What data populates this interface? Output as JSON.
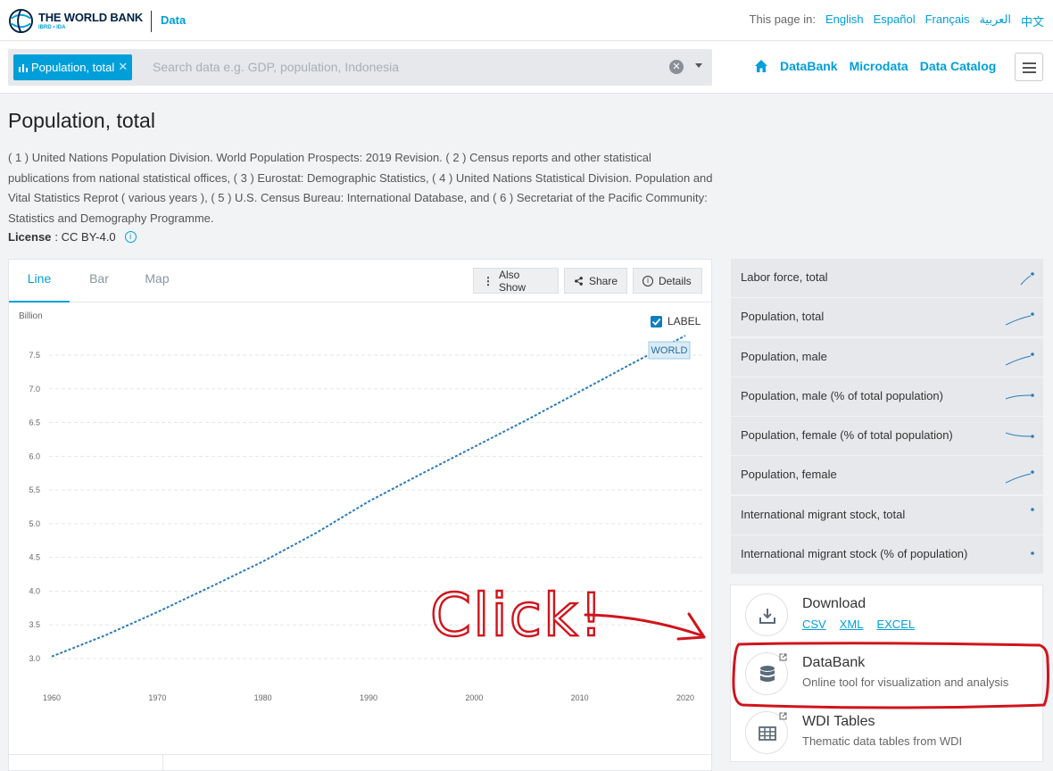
{
  "header": {
    "logo_main": "THE WORLD BANK",
    "logo_sub": "IBRD • IDA",
    "section": "Data",
    "lang_label": "This page in:",
    "languages": [
      "English",
      "Español",
      "Français",
      "العربية",
      "中文"
    ]
  },
  "search": {
    "chip_label": "Population, total",
    "placeholder": "Search data e.g. GDP, population, Indonesia"
  },
  "nav": {
    "links": [
      "DataBank",
      "Microdata",
      "Data Catalog"
    ]
  },
  "page": {
    "title": "Population, total",
    "source": "( 1 ) United Nations Population Division. World Population Prospects: 2019 Revision. ( 2 ) Census reports and other statistical publications from national statistical offices, ( 3 ) Eurostat: Demographic Statistics, ( 4 ) United Nations Statistical Division. Population and Vital Statistics Reprot ( various years ), ( 5 ) U.S. Census Bureau: International Database, and ( 6 ) Secretariat of the Pacific Community: Statistics and Demography Programme.",
    "license_label": "License",
    "license_value": ": CC BY-4.0"
  },
  "chart_tabs": [
    "Line",
    "Bar",
    "Map"
  ],
  "chart_buttons": [
    "Also Show",
    "Share",
    "Details"
  ],
  "chart_data": {
    "type": "line",
    "unit_label": "Billion",
    "label_checkbox": "LABEL",
    "series": [
      {
        "name": "WORLD",
        "x": [
          1960,
          1965,
          1970,
          1975,
          1980,
          1985,
          1990,
          1995,
          2000,
          2005,
          2010,
          2015,
          2020
        ],
        "y": [
          3.03,
          3.34,
          3.69,
          4.06,
          4.44,
          4.86,
          5.33,
          5.74,
          6.14,
          6.54,
          6.96,
          7.38,
          7.79
        ]
      }
    ],
    "xticks": [
      1960,
      1970,
      1980,
      1990,
      2000,
      2010,
      2020
    ],
    "yticks": [
      "3.0",
      "3.5",
      "4.0",
      "4.5",
      "5.0",
      "5.5",
      "6.0",
      "6.5",
      "7.0",
      "7.5"
    ],
    "xlim": [
      1960,
      2020
    ],
    "ylim": [
      3.0,
      7.5
    ],
    "grid": true
  },
  "related": [
    {
      "label": "Labor force, total",
      "spark": "rise-short"
    },
    {
      "label": "Population, total",
      "spark": "rise"
    },
    {
      "label": "Population, male",
      "spark": "rise"
    },
    {
      "label": "Population, male (% of total population)",
      "spark": "flat-up"
    },
    {
      "label": "Population, female (% of total population)",
      "spark": "flat-down"
    },
    {
      "label": "Population, female",
      "spark": "rise"
    },
    {
      "label": "International migrant stock, total",
      "spark": "dot"
    },
    {
      "label": "International migrant stock (% of population)",
      "spark": "dot"
    }
  ],
  "downloads": {
    "download_title": "Download",
    "formats": [
      "CSV",
      "XML",
      "EXCEL"
    ],
    "databank_title": "DataBank",
    "databank_sub": "Online tool for visualization and analysis",
    "wdi_title": "WDI Tables",
    "wdi_sub": "Thematic data tables from WDI"
  },
  "annotation": {
    "text": "Click!"
  },
  "colors": {
    "accent": "#009fda",
    "annotation": "#d0141c"
  }
}
